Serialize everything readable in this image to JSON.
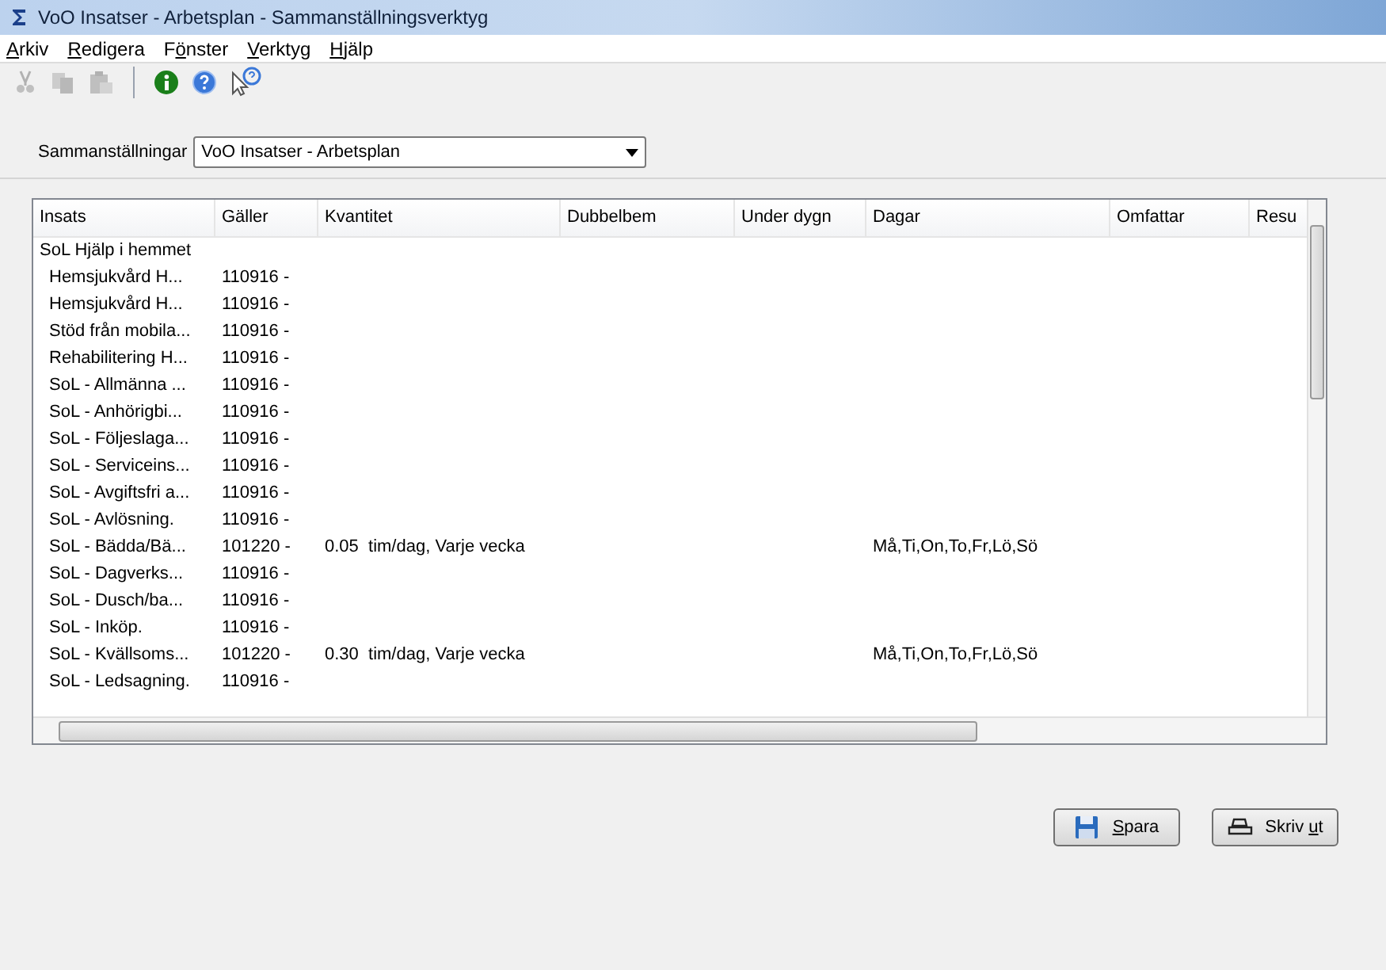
{
  "window": {
    "title": "VoO Insatser - Arbetsplan - Sammanställningsverktyg"
  },
  "menu": [
    {
      "key": "A",
      "after": "rkiv"
    },
    {
      "key": "R",
      "after": "edigera"
    },
    {
      "before": "F",
      "key": "ö",
      "after": "nster"
    },
    {
      "key": "V",
      "after": "erktyg"
    },
    {
      "key": "H",
      "after": "jälp"
    }
  ],
  "toolbar": [
    {
      "kind": "cut",
      "disabled": true
    },
    {
      "kind": "copy",
      "disabled": true
    },
    {
      "kind": "paste",
      "disabled": true
    },
    {
      "kind": "separator"
    },
    {
      "kind": "info",
      "disabled": false
    },
    {
      "kind": "help",
      "disabled": false
    },
    {
      "kind": "whatsthis",
      "disabled": false
    }
  ],
  "selector": {
    "label": "Sammanställningar",
    "value": "VoO Insatser - Arbetsplan"
  },
  "table": {
    "columns": [
      "Insats",
      "Gäller",
      "Kvantitet",
      "Dubbelbem",
      "Under dygn",
      "Dagar",
      "Omfattar",
      "Resu"
    ],
    "rows": [
      {
        "kind": "group",
        "insats": "SoL Hjälp i hemmet"
      },
      {
        "kind": "item",
        "insats": "Hemsjukvård H...",
        "galler": "110916 -"
      },
      {
        "kind": "item",
        "insats": "Hemsjukvård H...",
        "galler": "110916 -"
      },
      {
        "kind": "item",
        "insats": "Stöd från mobila...",
        "galler": "110916 -"
      },
      {
        "kind": "item",
        "insats": "Rehabilitering H...",
        "galler": "110916 -"
      },
      {
        "kind": "item",
        "insats": "SoL - Allmänna ...",
        "galler": "110916 -"
      },
      {
        "kind": "item",
        "insats": "SoL - Anhörigbi...",
        "galler": "110916 -"
      },
      {
        "kind": "item",
        "insats": "SoL - Följeslaga...",
        "galler": "110916 -"
      },
      {
        "kind": "item",
        "insats": "SoL - Serviceins...",
        "galler": "110916 -"
      },
      {
        "kind": "item",
        "insats": "SoL - Avgiftsfri a...",
        "galler": "110916 -"
      },
      {
        "kind": "item",
        "insats": "SoL - Avlösning.",
        "galler": "110916 -"
      },
      {
        "kind": "item",
        "insats": "SoL - Bädda/Bä...",
        "galler": "101220 -",
        "kvantitet": "0.05  tim/dag, Varje vecka",
        "dagar": "Må,Ti,On,To,Fr,Lö,Sö"
      },
      {
        "kind": "item",
        "insats": "SoL - Dagverks...",
        "galler": "110916 -"
      },
      {
        "kind": "item",
        "insats": "SoL - Dusch/ba...",
        "galler": "110916 -"
      },
      {
        "kind": "item",
        "insats": "SoL - Inköp.",
        "galler": "110916 -"
      },
      {
        "kind": "item",
        "insats": "SoL - Kvällsoms...",
        "galler": "101220 -",
        "kvantitet": "0.30  tim/dag, Varje vecka",
        "dagar": "Må,Ti,On,To,Fr,Lö,Sö"
      },
      {
        "kind": "item",
        "insats": "SoL - Ledsagning.",
        "galler": "110916 -"
      }
    ]
  },
  "buttons": [
    {
      "kind": "save",
      "key": "S",
      "after": "para"
    },
    {
      "kind": "print",
      "before": "Skriv ",
      "key": "u",
      "after": "t"
    }
  ]
}
